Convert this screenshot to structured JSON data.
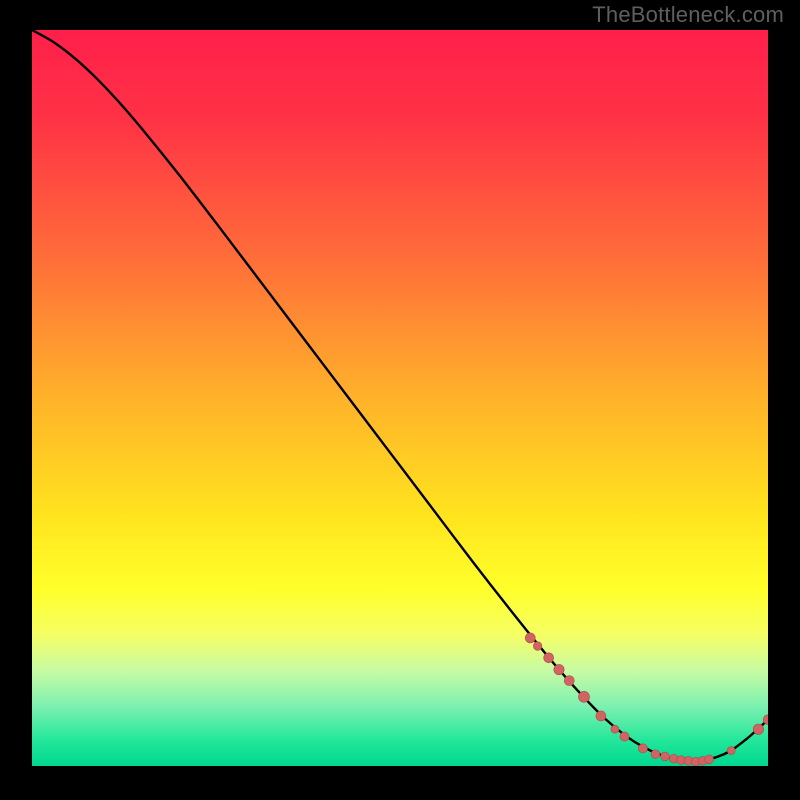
{
  "watermark": "TheBottleneck.com",
  "colors": {
    "page_bg": "#000000",
    "curve": "#000000",
    "marker": "#d16363",
    "marker_stroke": "#b24848"
  },
  "chart_data": {
    "type": "line",
    "title": "",
    "xlabel": "",
    "ylabel": "",
    "xlim": [
      0,
      100
    ],
    "ylim": [
      0,
      100
    ],
    "legend": false,
    "grid": false,
    "gradient_stops": [
      {
        "offset": 0.0,
        "color": "#ff1f4a"
      },
      {
        "offset": 0.12,
        "color": "#ff3246"
      },
      {
        "offset": 0.3,
        "color": "#ff6a3a"
      },
      {
        "offset": 0.5,
        "color": "#ffb22a"
      },
      {
        "offset": 0.66,
        "color": "#ffe41e"
      },
      {
        "offset": 0.76,
        "color": "#ffff2a"
      },
      {
        "offset": 0.82,
        "color": "#f6ff63"
      },
      {
        "offset": 0.87,
        "color": "#c8fba3"
      },
      {
        "offset": 0.92,
        "color": "#7af0b0"
      },
      {
        "offset": 0.965,
        "color": "#23e79a"
      },
      {
        "offset": 1.0,
        "color": "#00d890"
      }
    ],
    "series": [
      {
        "name": "bottleneck-curve",
        "x": [
          0.0,
          3.0,
          6.0,
          9.0,
          12.0,
          15.0,
          20.0,
          25.0,
          30.0,
          35.0,
          40.0,
          45.0,
          50.0,
          55.0,
          60.0,
          65.0,
          70.0,
          74.0,
          78.0,
          82.0,
          86.0,
          90.0,
          94.0,
          97.0,
          100.0
        ],
        "y": [
          100.0,
          98.3,
          96.0,
          93.2,
          90.0,
          86.5,
          80.3,
          73.8,
          67.2,
          60.6,
          54.0,
          47.4,
          40.8,
          34.2,
          27.6,
          21.2,
          15.0,
          10.4,
          6.3,
          3.2,
          1.3,
          0.6,
          1.6,
          3.6,
          6.3
        ]
      }
    ],
    "markers": [
      {
        "x": 67.7,
        "y": 17.4,
        "r": 5.0
      },
      {
        "x": 68.7,
        "y": 16.3,
        "r": 4.3
      },
      {
        "x": 70.2,
        "y": 14.7,
        "r": 5.0
      },
      {
        "x": 71.6,
        "y": 13.1,
        "r": 5.2
      },
      {
        "x": 73.0,
        "y": 11.6,
        "r": 5.0
      },
      {
        "x": 75.0,
        "y": 9.4,
        "r": 5.5
      },
      {
        "x": 77.3,
        "y": 6.8,
        "r": 5.0
      },
      {
        "x": 79.2,
        "y": 5.0,
        "r": 4.0
      },
      {
        "x": 80.5,
        "y": 4.0,
        "r": 4.6
      },
      {
        "x": 83.0,
        "y": 2.4,
        "r": 4.6
      },
      {
        "x": 84.7,
        "y": 1.6,
        "r": 4.4
      },
      {
        "x": 86.0,
        "y": 1.3,
        "r": 4.4
      },
      {
        "x": 87.2,
        "y": 1.0,
        "r": 4.4
      },
      {
        "x": 88.2,
        "y": 0.8,
        "r": 4.4
      },
      {
        "x": 89.2,
        "y": 0.7,
        "r": 4.4
      },
      {
        "x": 90.2,
        "y": 0.6,
        "r": 4.4
      },
      {
        "x": 91.1,
        "y": 0.7,
        "r": 4.4
      },
      {
        "x": 92.0,
        "y": 0.9,
        "r": 4.4
      },
      {
        "x": 95.0,
        "y": 2.1,
        "r": 4.0
      },
      {
        "x": 98.7,
        "y": 5.0,
        "r": 5.2
      },
      {
        "x": 100.0,
        "y": 6.3,
        "r": 4.8
      }
    ]
  }
}
